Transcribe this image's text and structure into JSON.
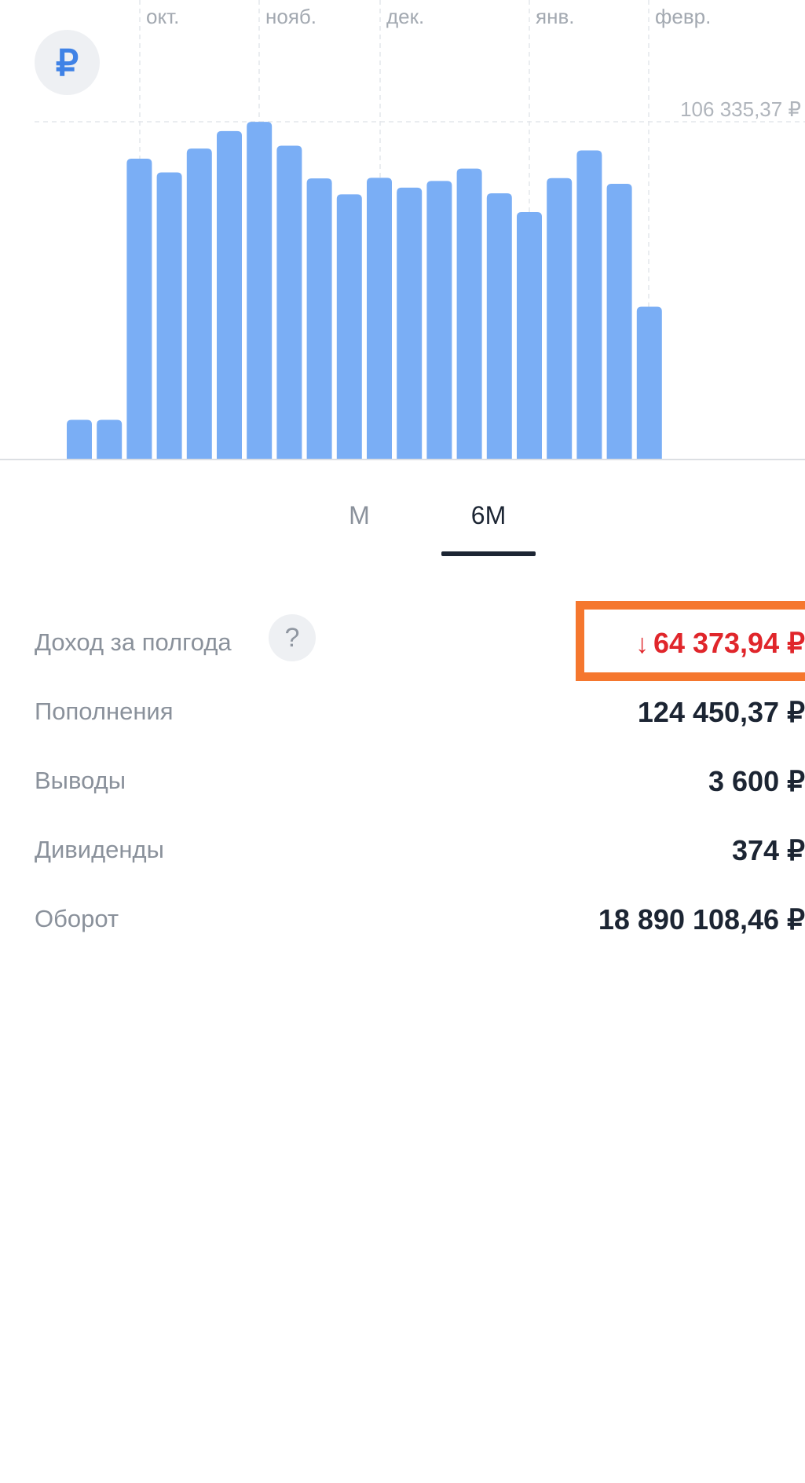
{
  "header": {
    "currency_symbol": "₽"
  },
  "chart_data": {
    "type": "bar",
    "month_labels": [
      "окт.",
      "нояб.",
      "дек.",
      "янв.",
      "февр."
    ],
    "max_label": "106 335,37 ₽",
    "ylim": [
      0,
      106335.37
    ],
    "values": [
      12500,
      12500,
      94700,
      90400,
      97900,
      103400,
      106300,
      98800,
      88500,
      83500,
      88700,
      85600,
      87700,
      91600,
      83800,
      77900,
      88600,
      97300,
      86800,
      48100
    ],
    "bar_color": "#7aaef5",
    "grid_color": "#e4e7eb"
  },
  "tabs": [
    {
      "label": "М",
      "active": false
    },
    {
      "label": "6М",
      "active": true
    }
  ],
  "summary": {
    "income_label": "Доход за полгода",
    "help_symbol": "?",
    "income_arrow": "➜",
    "income_value": "64 373,94 ₽",
    "deposits_label": "Пополнения",
    "deposits_value": "124 450,37 ₽",
    "withdrawals_label": "Выводы",
    "withdrawals_value": "3 600 ₽",
    "dividends_label": "Дивиденды",
    "dividends_value": "374 ₽",
    "turnover_label": "Оборот",
    "turnover_value": "18 890 108,46 ₽"
  },
  "colors": {
    "accent": "#3f82e6",
    "negative": "#e0262b",
    "highlight": "#f5772e"
  }
}
